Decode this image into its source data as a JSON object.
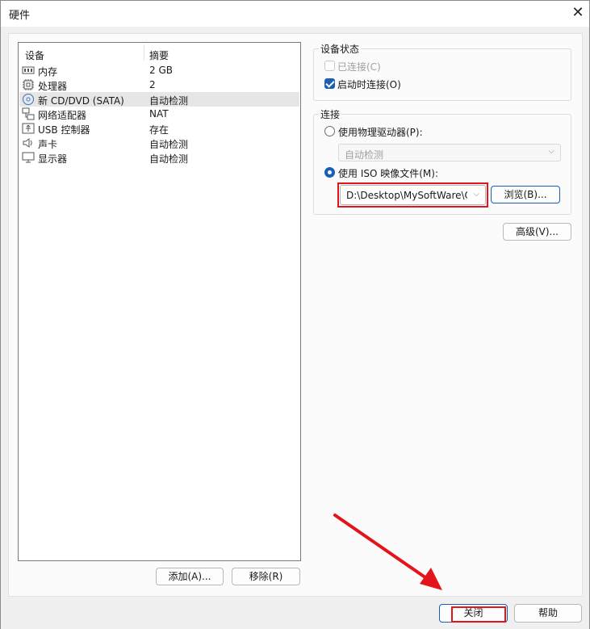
{
  "window": {
    "title": "硬件",
    "close_glyph": "✕"
  },
  "device_list": {
    "headers": {
      "device": "设备",
      "summary": "摘要"
    },
    "rows": [
      {
        "name": "内存",
        "summary": "2 GB",
        "icon": "memory-icon"
      },
      {
        "name": "处理器",
        "summary": "2",
        "icon": "cpu-icon"
      },
      {
        "name": "新 CD/DVD (SATA)",
        "summary": "自动检测",
        "icon": "cd-dvd-icon",
        "selected": true
      },
      {
        "name": "网络适配器",
        "summary": "NAT",
        "icon": "network-icon"
      },
      {
        "name": "USB 控制器",
        "summary": "存在",
        "icon": "usb-icon"
      },
      {
        "name": "声卡",
        "summary": "自动检测",
        "icon": "sound-icon"
      },
      {
        "name": "显示器",
        "summary": "自动检测",
        "icon": "display-icon"
      }
    ],
    "add_label": "添加(A)...",
    "remove_label": "移除(R)"
  },
  "device_status": {
    "title": "设备状态",
    "connected_label": "已连接(C)",
    "connected_checked": false,
    "connected_enabled": false,
    "connect_at_power_on_label": "启动时连接(O)",
    "connect_at_power_on_checked": true
  },
  "connection": {
    "title": "连接",
    "physical_drive_label": "使用物理驱动器(P):",
    "physical_drive_value": "自动检测",
    "iso_label": "使用 ISO 映像文件(M):",
    "iso_path": "D:\\Desktop\\MySoftWare\\OS",
    "browse_label": "浏览(B)...",
    "selected_option": "iso"
  },
  "advanced_label": "高级(V)...",
  "footer": {
    "close_label": "关闭",
    "help_label": "帮助"
  },
  "colors": {
    "accent": "#1a5fb4",
    "annotation_red": "#e4141b"
  }
}
